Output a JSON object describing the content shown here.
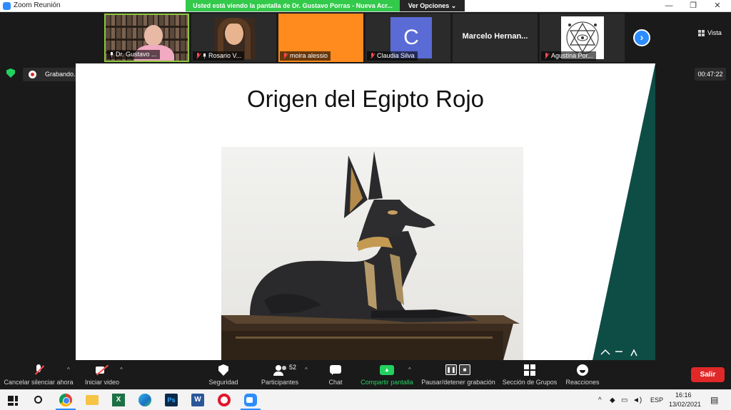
{
  "window": {
    "title": "Zoom Reunión",
    "minimize": "—",
    "restore": "❐",
    "close": "✕"
  },
  "share_banner": {
    "text": "Usted está viendo la pantalla de Dr. Gustavo Porras - Nueva Acr...",
    "view_options": "Ver Opciones"
  },
  "participants": [
    {
      "name": "Dr. Gustavo ...",
      "muted": false,
      "pinned": true
    },
    {
      "name": "Rosario V...",
      "muted": true,
      "pinned": true
    },
    {
      "name": "moira alessio",
      "muted": true,
      "pinned": false
    },
    {
      "name": "Claudia Silva",
      "muted": true,
      "pinned": false,
      "avatar_letter": "C"
    },
    {
      "name": "Marcelo  Hernan...",
      "muted": false,
      "pinned": false
    },
    {
      "name": "Agustina Por...",
      "muted": true,
      "pinned": false
    }
  ],
  "view_button": {
    "label": "Vista"
  },
  "recording": {
    "status": "Grabando...",
    "pause": "❚❚",
    "stop": "■"
  },
  "meeting_timer": "00:47:22",
  "slide": {
    "title": "Origen del Egipto Rojo"
  },
  "toolbar": {
    "mute": "Cancelar silenciar ahora",
    "video": "Iniciar video",
    "security": "Seguridad",
    "participants": "Participantes",
    "participant_count": "52",
    "chat": "Chat",
    "share": "Compartir pantalla",
    "pause_recording": "Pausar/detener grabación",
    "breakout": "Sección de Grupos",
    "reactions": "Reacciones",
    "leave": "Salir",
    "caret": "^"
  },
  "taskbar": {
    "language": "ESP",
    "time": "16:16",
    "date": "13/02/2021",
    "excel": "X",
    "photoshop": "Ps",
    "word": "W",
    "tray_chevron": "^"
  },
  "colors": {
    "zoom_blue": "#2d8cff",
    "share_green": "#23d160",
    "leave_red": "#e02828",
    "slide_teal": "#0e4d45"
  }
}
